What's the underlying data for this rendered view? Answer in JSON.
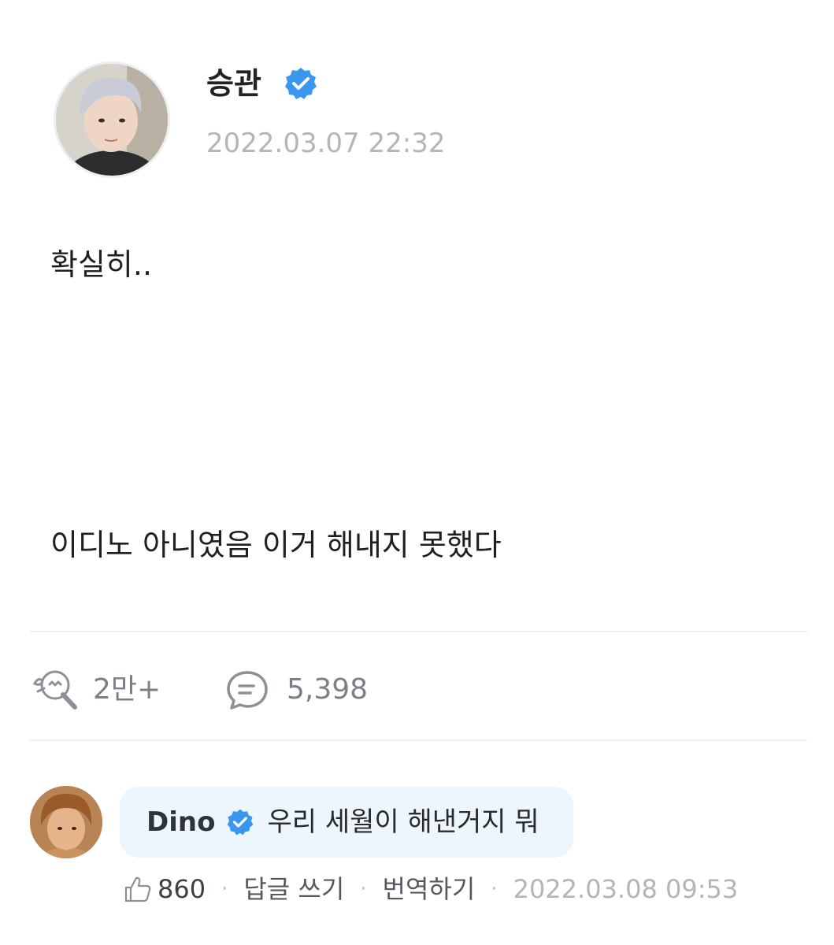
{
  "post": {
    "author": "승관",
    "timestamp": "2022.03.07 22:32",
    "lines": [
      "확실히..",
      "이디노 아니였음 이거 해내지 못했다"
    ],
    "likes_count": "2만+",
    "comments_count": "5,398"
  },
  "comment": {
    "author": "Dino",
    "text": "우리 세월이 해낸거지 뭐",
    "likes": "860",
    "reply_label": "답글 쓰기",
    "translate_label": "번역하기",
    "separator": "·",
    "timestamp": "2022.03.08 09:53"
  },
  "colors": {
    "verified_badge": "#3a97f0",
    "bubble_bg": "#eef6fd",
    "timestamp_gray": "#b3b5bb"
  },
  "icons": {
    "verified": "verified-check-icon",
    "likes": "lightstick-icon",
    "comments": "comment-bubble-icon",
    "comment_like": "thumbs-up-icon"
  }
}
